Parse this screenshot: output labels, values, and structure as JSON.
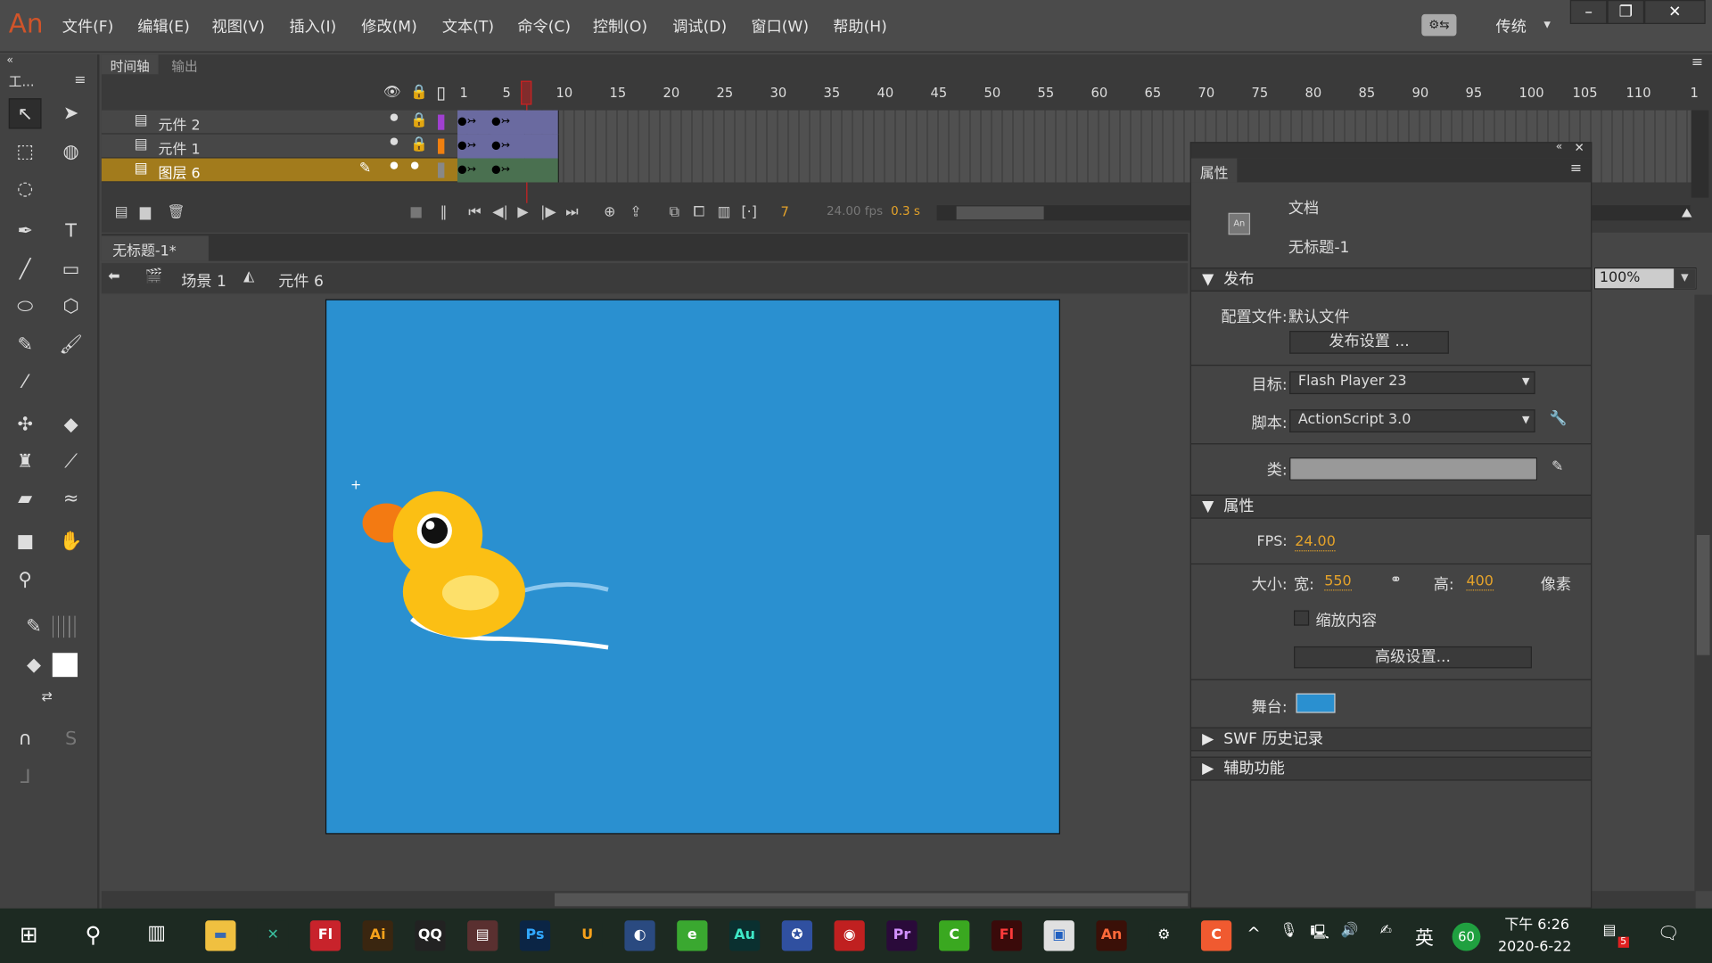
{
  "app": {
    "logo": "An",
    "menus": [
      "文件(F)",
      "编辑(E)",
      "视图(V)",
      "插入(I)",
      "修改(M)",
      "文本(T)",
      "命令(C)",
      "控制(O)",
      "调试(D)",
      "窗口(W)",
      "帮助(H)"
    ],
    "workspace": "传统",
    "window_buttons": [
      "minimize",
      "restore",
      "close"
    ]
  },
  "tools": {
    "header": "工...",
    "items": [
      "selection",
      "subselection",
      "free-transform",
      "3d-rotation",
      "lasso",
      "pen",
      "text",
      "line",
      "rectangle",
      "oval",
      "polystar",
      "pencil",
      "paint-brush",
      "brush",
      "bone",
      "paint-bucket",
      "ink-bottle",
      "eyedropper",
      "eraser",
      "width",
      "camera",
      "hand",
      "zoom",
      "stroke-color",
      "fill-color",
      "swap-colors",
      "snap",
      "smooth",
      "straighten"
    ]
  },
  "timeline": {
    "tabs": [
      "时间轴",
      "输出"
    ],
    "ruler": [
      "1",
      "5",
      "10",
      "15",
      "20",
      "25",
      "30",
      "35",
      "40",
      "45",
      "50",
      "55",
      "60",
      "65",
      "70",
      "75",
      "80",
      "85",
      "90",
      "95",
      "100",
      "105",
      "110",
      "1"
    ],
    "layers": [
      {
        "name": "元件 2",
        "color": "#a040d0",
        "locked": true
      },
      {
        "name": "元件 1",
        "color": "#f08010",
        "locked": true
      },
      {
        "name": "图层 6",
        "color": "#888888",
        "locked": false,
        "selected": true
      }
    ],
    "current_frame": "7",
    "fps": "24.00 fps",
    "time": "0.3 s"
  },
  "document": {
    "tab": "无标题-1*",
    "scene": "场景 1",
    "symbol": "元件 6",
    "zoom": "100%",
    "stage_color": "#2a90d0"
  },
  "properties": {
    "tab": "属性",
    "type": "文档",
    "doc_name": "无标题-1",
    "publish": {
      "title": "发布",
      "profile_label": "配置文件:",
      "profile": "默认文件",
      "settings_button": "发布设置 ...",
      "target_label": "目标:",
      "target": "Flash Player 23",
      "script_label": "脚本:",
      "script": "ActionScript 3.0",
      "class_label": "类:",
      "class_value": ""
    },
    "props": {
      "title": "属性",
      "fps_label": "FPS:",
      "fps": "24.00",
      "size_label": "大小:",
      "width_label": "宽:",
      "width": "550",
      "height_label": "高:",
      "height": "400",
      "unit": "像素",
      "scale_content": "缩放内容",
      "scale_checked": false,
      "advanced_button": "高级设置...",
      "stage_label": "舞台:"
    },
    "swf_history": "SWF 历史记录",
    "accessibility": "辅助功能"
  },
  "taskbar": {
    "apps": [
      {
        "label": "Fl",
        "bg": "#c8232b"
      },
      {
        "label": "Ai",
        "bg": "#3a2610",
        "fg": "#f7a21b"
      },
      {
        "label": "QQ",
        "bg": "#222"
      },
      {
        "label": "▤",
        "bg": "#5a3030"
      },
      {
        "label": "Ps",
        "bg": "#0b2545",
        "fg": "#31a8ff"
      },
      {
        "label": "U",
        "bg": "#1d2a22",
        "fg": "#f7a21b"
      },
      {
        "label": "◐",
        "bg": "#2a4a80"
      },
      {
        "label": "e",
        "bg": "#3aa830"
      },
      {
        "label": "Au",
        "bg": "#0a3030",
        "fg": "#3ee8c8"
      },
      {
        "label": "✪",
        "bg": "#3050a0"
      },
      {
        "label": "◉",
        "bg": "#c02020"
      },
      {
        "label": "Pr",
        "bg": "#2a0a3a",
        "fg": "#d291ff"
      },
      {
        "label": "C",
        "bg": "#3aa820"
      },
      {
        "label": "Fl",
        "bg": "#3a0a0a",
        "fg": "#ff3a3a"
      },
      {
        "label": "▣",
        "bg": "#e0e0e0",
        "fg": "#2060c0"
      },
      {
        "label": "An",
        "bg": "#3a1008",
        "fg": "#ff6a3a"
      },
      {
        "label": "⚙",
        "bg": "#1d2a22"
      },
      {
        "label": "C",
        "bg": "#f05a30"
      }
    ],
    "tray": {
      "ime": "英",
      "badge": "60",
      "time": "下午 6:26",
      "date": "2020-6-22",
      "notif": "5"
    }
  }
}
